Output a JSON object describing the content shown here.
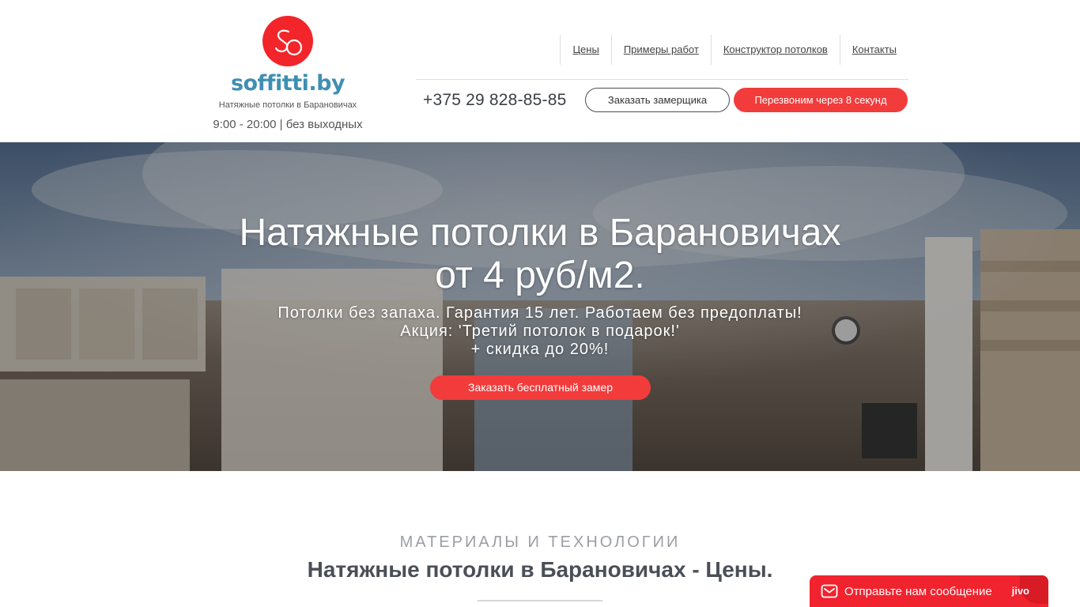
{
  "header": {
    "logo_text": "soffitti.by",
    "logo_monogram": "SO",
    "tagline": "Натяжные потолки в Барановичах",
    "hours": "9:00 - 20:00 | без выходных",
    "nav": [
      {
        "label": "Цены"
      },
      {
        "label": "Примеры работ"
      },
      {
        "label": "Конструктор потолков"
      },
      {
        "label": "Контакты"
      }
    ],
    "phone": "+375 29 828-85-85",
    "measure_button": "Заказать замерщика",
    "callback_button": "Перезвоним через 8 секунд"
  },
  "hero": {
    "title_line1": "Натяжные потолки в Барановичах",
    "title_line2": "от 4 руб/м2.",
    "sub_line1": "Потолки без запаха. Гарантия 15 лет. Работаем без предоплаты!",
    "sub_line2": "Акция: 'Третий потолок в подарок!'",
    "sub_line3": "+ скидка до 20%!",
    "cta_button": "Заказать бесплатный замер"
  },
  "section": {
    "kicker": "МАТЕРИАЛЫ И ТЕХНОЛОГИИ",
    "title": "Натяжные потолки в Барановичах - Цены."
  },
  "chat": {
    "text": "Отправьте нам сообщение",
    "brand": "jivo",
    "icon": "mail-icon"
  },
  "colors": {
    "accent_red": "#f23b3b",
    "logo_blue": "#3f8fb3",
    "text_dark": "#4a4f57"
  }
}
